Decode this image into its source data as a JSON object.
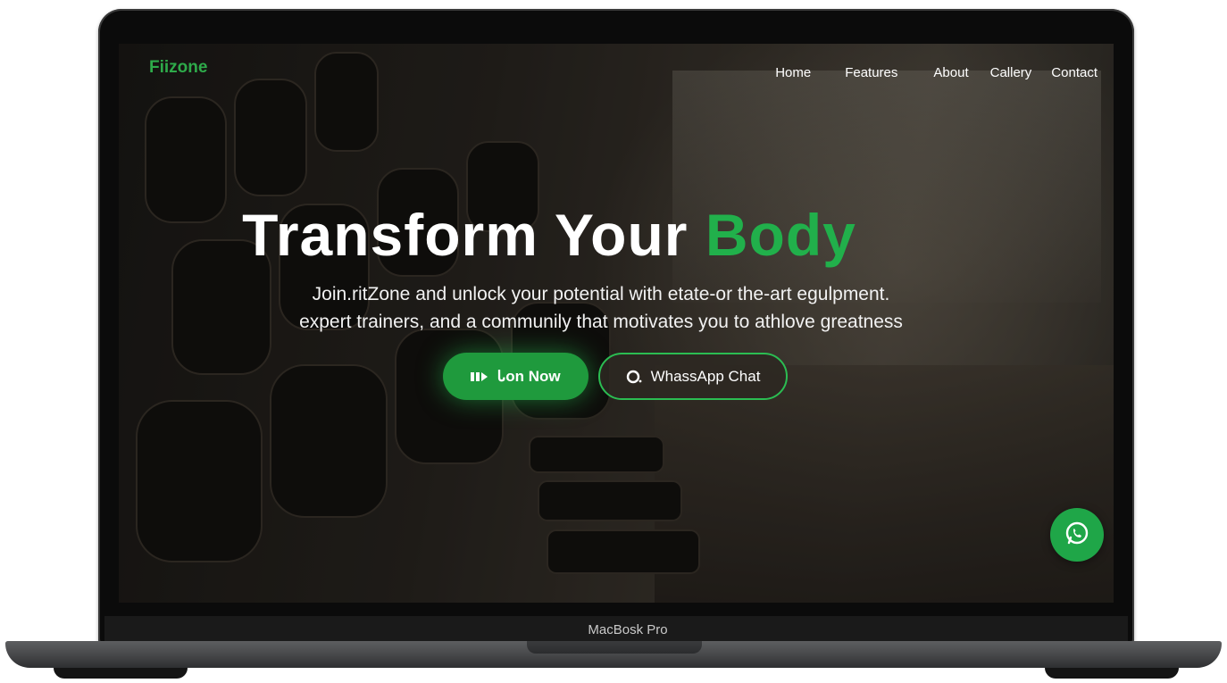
{
  "site": {
    "logo": "Fiizone",
    "nav": [
      "Home",
      "Features",
      "About",
      "Callery",
      "Contact"
    ]
  },
  "hero": {
    "title_main": "Transform Your",
    "title_accent": "Body",
    "subtitle_line1": "Join.ritZone and unlock your potential with etate-or  the-art egulpment.",
    "subtitle_line2": "expert trainers, and a communily that motivates you to athlove greatness"
  },
  "buttons": {
    "join_label": "Ꮣon Now",
    "chat_label": "WhassApp Chat"
  },
  "device": {
    "label": "MacBosk Pro"
  },
  "colors": {
    "accent": "#21b04b",
    "button_green": "#1f9a3d"
  },
  "icons": {
    "join": "membership-card-icon",
    "chat": "chat-bubble-icon",
    "fab": "whatsapp-icon"
  }
}
